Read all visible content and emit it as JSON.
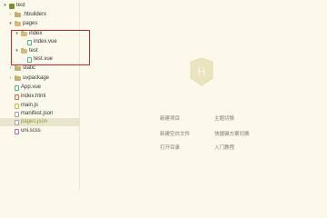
{
  "tree": {
    "project": "test",
    "items": [
      {
        "label": ".hbuilderx"
      },
      {
        "label": "pages"
      },
      {
        "label": "index"
      },
      {
        "label": "index.vue"
      },
      {
        "label": "test"
      },
      {
        "label": "test.vue"
      },
      {
        "label": "static"
      },
      {
        "label": "uvpackage"
      },
      {
        "label": "App.vue"
      },
      {
        "label": "index.html"
      },
      {
        "label": "main.js"
      },
      {
        "label": "manifest.json"
      },
      {
        "label": "pages.json"
      },
      {
        "label": "uni.scss"
      }
    ]
  },
  "welcome": {
    "logo_letter": "H",
    "actions": {
      "new_project": "新建项目",
      "theme_switch": "主题切换",
      "new_blank_file": "新建空白文件",
      "shortcut_scheme": "快捷键方案切换",
      "open_folder": "打开目录",
      "getting_started": "入门教程"
    }
  },
  "colors": {
    "background": "#fbf9ec",
    "highlight_box": "#d9212c",
    "active_text": "#8a9a35"
  }
}
